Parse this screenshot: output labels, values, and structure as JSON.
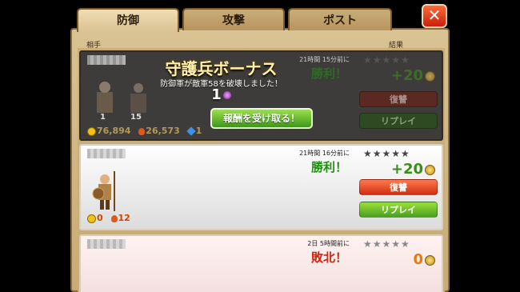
{
  "tabs": [
    {
      "label": "防御",
      "active": true
    },
    {
      "label": "攻撃",
      "active": false
    },
    {
      "label": "ポスト",
      "active": false
    }
  ],
  "close_icon": "✕",
  "columns": {
    "opponent": "相手",
    "result": "結果"
  },
  "bonus": {
    "title": "守護兵ボーナス",
    "description": "防御軍が敵軍58を破壊しました！",
    "amount": "1",
    "claim_label": "報酬を受け取る！"
  },
  "battles": [
    {
      "time": "21時間 15分前に",
      "result": "勝利！",
      "trophies": "+20",
      "stars": "★★★★★",
      "gold": "76,894",
      "elixir": "26,573",
      "dark_elixir": "1",
      "units": [
        "1",
        "15"
      ],
      "revenge_label": "復讐",
      "replay_label": "リプレイ"
    },
    {
      "time": "21時間 16分前に",
      "result": "勝利！",
      "trophies": "+20",
      "stars": "★★★★★",
      "gold": "0",
      "elixir": "12",
      "revenge_label": "復讐",
      "replay_label": "リプレイ"
    },
    {
      "time": "2日 5時間前に",
      "result": "敗北！",
      "trophies": "0",
      "stars": "★★★★★"
    }
  ],
  "colors": {
    "win": "#1f8f10",
    "loss": "#d0230f",
    "accent_gold": "#fff2a8"
  }
}
